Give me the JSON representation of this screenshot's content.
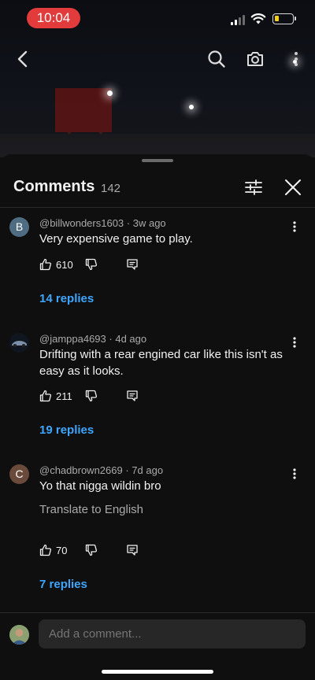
{
  "status_bar": {
    "time": "10:04"
  },
  "comments_header": {
    "title": "Comments",
    "count": "142"
  },
  "comments": [
    {
      "avatar_letter": "B",
      "avatar_color": "#4e6d82",
      "author": "@billwonders1603",
      "age": "3w ago",
      "text": "Very expensive game to play.",
      "likes": "610",
      "replies": "14 replies"
    },
    {
      "avatar_letter": "",
      "avatar_color": "#10161f",
      "author": "@jamppa4693",
      "age": "4d ago",
      "text": "Drifting with a rear engined car like this isn't as easy as it looks.",
      "likes": "211",
      "replies": "19 replies"
    },
    {
      "avatar_letter": "C",
      "avatar_color": "#6a4a3a",
      "author": "@chadbrown2669",
      "age": "7d ago",
      "text": "Yo that nigga wildin bro",
      "translate": "Translate to English",
      "likes": "70",
      "replies": "7 replies"
    }
  ],
  "comment_input": {
    "placeholder": "Add a comment..."
  },
  "colors": {
    "accent": "#3ea6ff",
    "background": "#0f0f0f",
    "time_pill": "#e23b3b"
  },
  "icons": [
    "back-arrow-icon",
    "search-icon",
    "camera-icon",
    "more-icon",
    "filter-icon",
    "close-icon",
    "thumbs-up-icon",
    "thumbs-down-icon",
    "reply-icon",
    "kebab-menu-icon"
  ]
}
